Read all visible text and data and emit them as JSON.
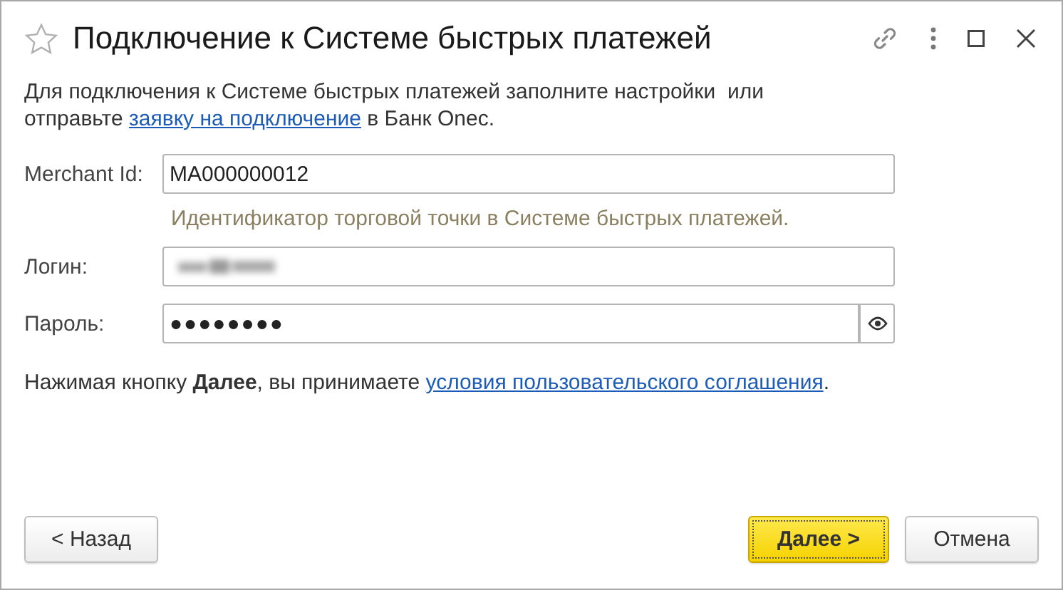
{
  "window": {
    "title": "Подключение к Системе быстрых платежей",
    "favorite": false
  },
  "intro": {
    "before": "Для подключения к Системе быстрых платежей заполните настройки  или отправьте ",
    "link": "заявку на подключение",
    "after": " в Банк Onec."
  },
  "fields": [
    {
      "kind": "text",
      "label": "Merchant Id:",
      "value": "MA000000012",
      "hint": "Идентификатор торговой точки в Системе быстрых платежей."
    },
    {
      "kind": "redacted",
      "label": "Логин:"
    },
    {
      "kind": "password",
      "label": "Пароль:",
      "value": "●●●●●●●●"
    }
  ],
  "agreement": {
    "before": "Нажимая кнопку ",
    "bold": "Далее",
    "middle": ", вы принимаете ",
    "link": "условия пользовательского соглашения",
    "after": "."
  },
  "buttons": [
    {
      "label": "< Назад",
      "kind": "left",
      "default": false
    },
    {
      "label": "Далее >",
      "kind": "right",
      "default": true
    },
    {
      "label": "Отмена",
      "kind": "right",
      "default": false
    }
  ]
}
